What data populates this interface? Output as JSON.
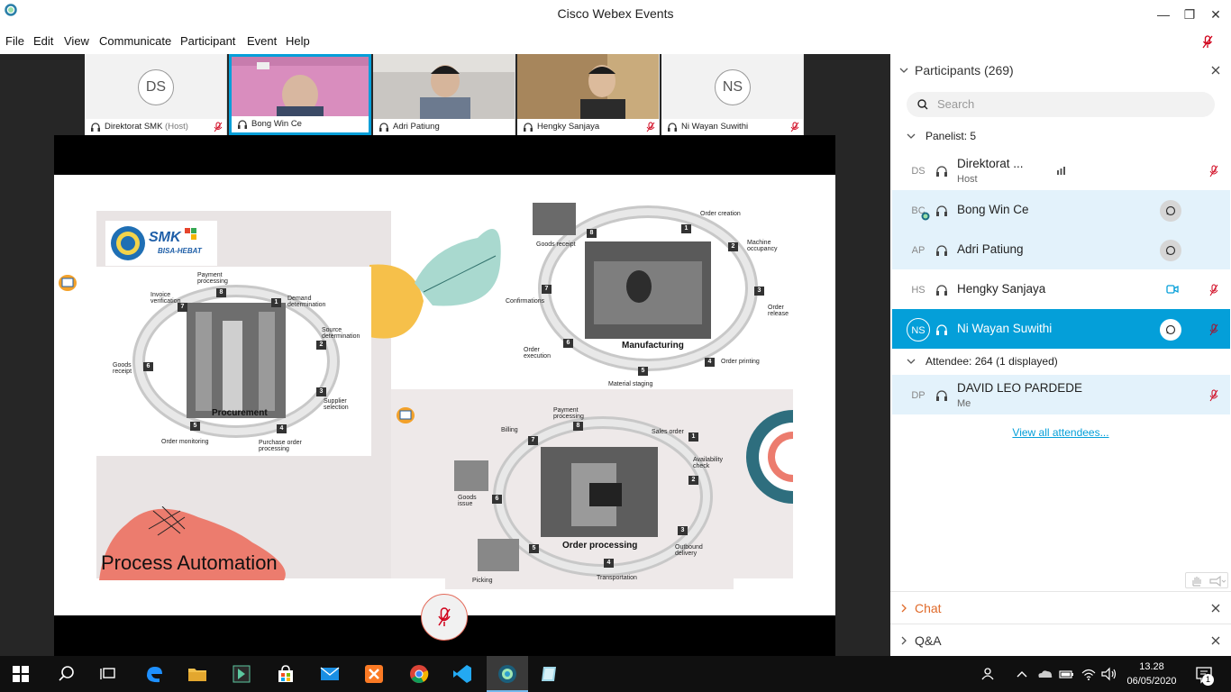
{
  "window": {
    "title": "Cisco Webex Events"
  },
  "menu": [
    "File",
    "Edit",
    "View",
    "Communicate",
    "Participant",
    "Event",
    "Help"
  ],
  "thumbnails": [
    {
      "initials": "DS",
      "name": "Direktorat SMK",
      "role": "(Host)"
    },
    {
      "name": "Bong Win Ce"
    },
    {
      "name": "Adri Patiung"
    },
    {
      "name": "Hengky Sanjaya"
    },
    {
      "initials": "NS",
      "name": "Ni Wayan Suwithi"
    }
  ],
  "slide": {
    "title": "Process Automation",
    "logo_text": "SMK",
    "logo_sub": "BISA-HEBAT",
    "procurement": {
      "title": "Procurement",
      "steps": [
        {
          "n": "1",
          "label": "Demand determination"
        },
        {
          "n": "2",
          "label": "Source determination"
        },
        {
          "n": "3",
          "label": "Supplier selection"
        },
        {
          "n": "4",
          "label": "Purchase order processing"
        },
        {
          "n": "5",
          "label": "Order monitoring"
        },
        {
          "n": "6",
          "label": "Goods receipt"
        },
        {
          "n": "7",
          "label": "Invoice verification"
        },
        {
          "n": "8",
          "label": "Payment processing"
        }
      ]
    },
    "manufacturing": {
      "title": "Manufacturing",
      "steps": [
        {
          "n": "1",
          "label": "Order creation"
        },
        {
          "n": "2",
          "label": "Machine occupancy"
        },
        {
          "n": "3",
          "label": "Order release"
        },
        {
          "n": "4",
          "label": "Order printing"
        },
        {
          "n": "5",
          "label": "Material staging"
        },
        {
          "n": "6",
          "label": "Order execution"
        },
        {
          "n": "7",
          "label": "Confirmations"
        },
        {
          "n": "8",
          "label": "Goods receipt"
        }
      ]
    },
    "order_processing": {
      "title": "Order processing",
      "steps": [
        {
          "n": "1",
          "label": "Sales order"
        },
        {
          "n": "2",
          "label": "Availability check"
        },
        {
          "n": "3",
          "label": "Outbound delivery"
        },
        {
          "n": "4",
          "label": "Transportation"
        },
        {
          "n": "5",
          "label": "Picking"
        },
        {
          "n": "6",
          "label": "Goods issue"
        },
        {
          "n": "7",
          "label": "Billing"
        },
        {
          "n": "8",
          "label": "Payment processing"
        }
      ]
    }
  },
  "participants_panel": {
    "header": "Participants (269)",
    "search_placeholder": "Search",
    "panelist_header": "Panelist: 5",
    "panelists": [
      {
        "initials": "DS",
        "name": "Direktorat ...",
        "sub": "Host"
      },
      {
        "initials": "BC",
        "name": "Bong Win Ce"
      },
      {
        "initials": "AP",
        "name": "Adri Patiung"
      },
      {
        "initials": "HS",
        "name": "Hengky Sanjaya"
      },
      {
        "initials": "NS",
        "name": "Ni Wayan Suwithi"
      }
    ],
    "attendee_header": "Attendee: 264 (1 displayed)",
    "attendees": [
      {
        "initials": "DP",
        "name": "DAVID LEO PARDEDE",
        "sub": "Me"
      }
    ],
    "view_all": "View all attendees...",
    "chat_label": "Chat",
    "qa_label": "Q&A"
  },
  "taskbar": {
    "time": "13.28",
    "date": "06/05/2020",
    "notif_count": "1"
  },
  "colors": {
    "accent": "#049fd9",
    "selected_row": "#049fd9",
    "highlight_row": "#e3f2fb",
    "mute_red": "#d0021b",
    "slide_coral": "#ec7c6e"
  }
}
